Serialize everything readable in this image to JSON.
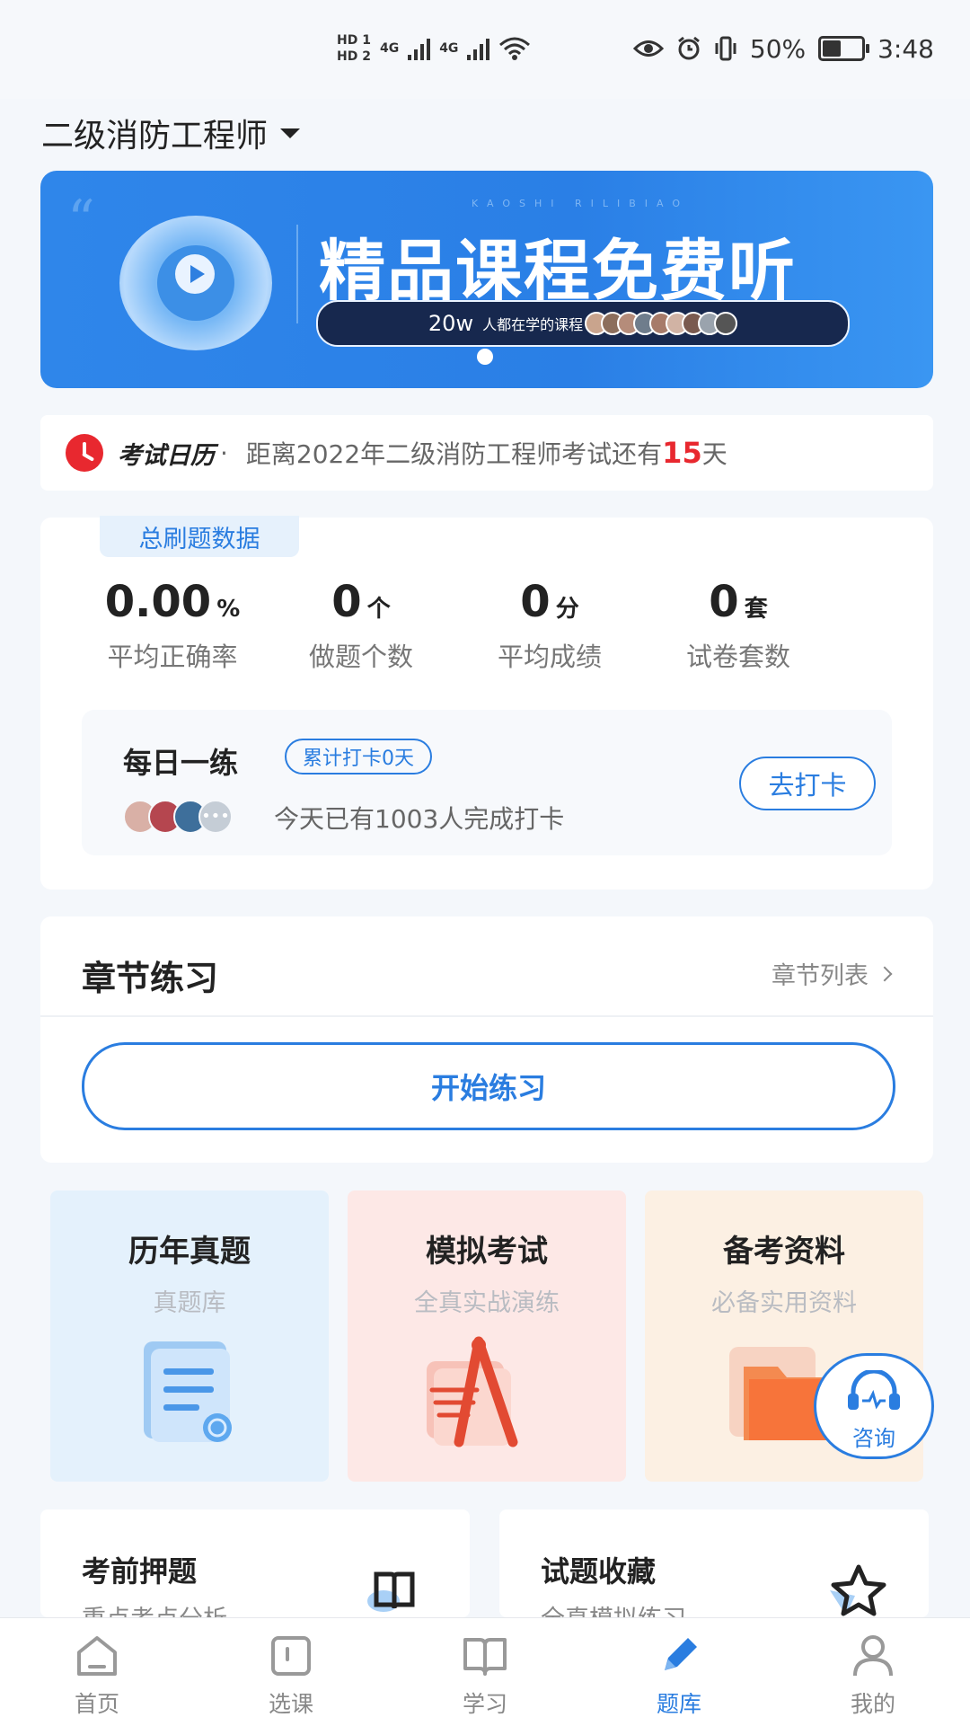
{
  "status_bar": {
    "hd1": "HD 1",
    "hd2": "HD 2",
    "net1": "4G",
    "net2": "4G",
    "battery_text": "50%",
    "battery_level": 0.5,
    "time": "3:48"
  },
  "header": {
    "exam_selector": "二级消防工程师"
  },
  "banner": {
    "title": "精品课程免费听",
    "watermark": "KAOSHI RILIBIAO",
    "pill_count": "20w",
    "pill_text": "人都在学的课程"
  },
  "calendar": {
    "label": "考试日历",
    "sep": "·",
    "text_prefix": "距离2022年二级消防工程师考试还有",
    "days": "15",
    "text_suffix": "天"
  },
  "stats": {
    "tag": "总刷题数据",
    "items": [
      {
        "value": "0.00",
        "unit": "%",
        "label": "平均正确率"
      },
      {
        "value": "0",
        "unit": "个",
        "label": "做题个数"
      },
      {
        "value": "0",
        "unit": "分",
        "label": "平均成绩"
      },
      {
        "value": "0",
        "unit": "套",
        "label": "试卷套数"
      }
    ],
    "daily": {
      "title": "每日一练",
      "badge": "累计打卡0天",
      "completed_text": "今天已有1003人完成打卡",
      "button": "去打卡"
    }
  },
  "chapter": {
    "title": "章节练习",
    "link": "章节列表",
    "start_button": "开始练习"
  },
  "features": [
    {
      "title": "历年真题",
      "subtitle": "真题库"
    },
    {
      "title": "模拟考试",
      "subtitle": "全真实战演练"
    },
    {
      "title": "备考资料",
      "subtitle": "必备实用资料"
    }
  ],
  "consult": {
    "label": "咨询"
  },
  "bottom_cards": [
    {
      "title": "考前押题",
      "subtitle": "重点考点分析"
    },
    {
      "title": "试题收藏",
      "subtitle": "全真模拟练习"
    }
  ],
  "tabs": [
    {
      "label": "首页",
      "icon": "home-icon"
    },
    {
      "label": "选课",
      "icon": "course-icon"
    },
    {
      "label": "学习",
      "icon": "book-icon"
    },
    {
      "label": "题库",
      "icon": "pencil-icon",
      "active": true
    },
    {
      "label": "我的",
      "icon": "user-icon"
    }
  ],
  "colors": {
    "accent": "#2a7de0",
    "alert": "#e8282f"
  }
}
